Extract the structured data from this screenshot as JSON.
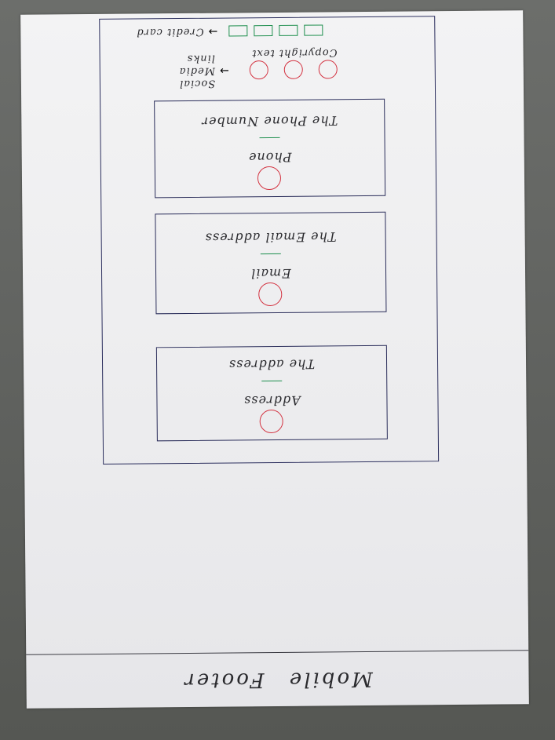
{
  "title": "Mobile Footer",
  "cards": [
    {
      "label": "Address",
      "value": "The address"
    },
    {
      "label": "Email",
      "value": "The Email address"
    },
    {
      "label": "Phone",
      "value": "The Phone Number"
    }
  ],
  "social": {
    "note": "Social Media links"
  },
  "copyright": {
    "text": "Copyright text"
  },
  "payment": {
    "note": "Credit card"
  },
  "colors": {
    "circle": "#d33240",
    "accent_line": "#1e8f4e",
    "frame": "#2c2f5e"
  }
}
